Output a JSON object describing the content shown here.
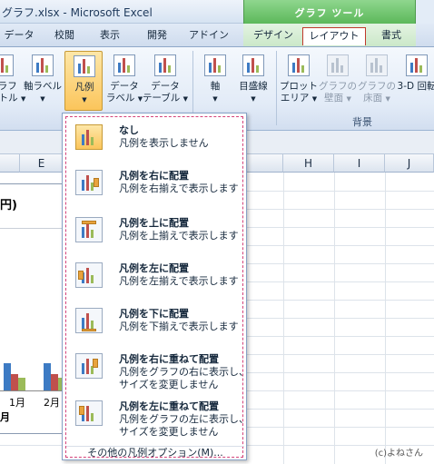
{
  "window": {
    "title": "グラフ.xlsx - Microsoft Excel",
    "context_tab_group": "グラフ ツール"
  },
  "tabs": [
    {
      "label": "データ"
    },
    {
      "label": "校閲"
    },
    {
      "label": "表示"
    },
    {
      "label": "開発"
    },
    {
      "label": "アドイン"
    },
    {
      "label": "デザイン"
    },
    {
      "label": "レイアウト",
      "active": true
    },
    {
      "label": "書式"
    }
  ],
  "ribbon": {
    "buttons": [
      {
        "line1": "グラフ",
        "line2": "タイトル",
        "icon": "chart-title-icon"
      },
      {
        "line1": "軸ラベル",
        "line2": "",
        "icon": "axis-label-icon"
      },
      {
        "line1": "凡例",
        "line2": "",
        "icon": "legend-icon",
        "pressed": true
      },
      {
        "line1": "データ",
        "line2": "ラベル",
        "icon": "data-label-icon"
      },
      {
        "line1": "データ",
        "line2": "テーブル",
        "icon": "data-table-icon"
      },
      {
        "line1": "軸",
        "line2": "",
        "icon": "axis-icon"
      },
      {
        "line1": "目盛線",
        "line2": "",
        "icon": "gridlines-icon"
      },
      {
        "line1": "プロット",
        "line2": "エリア",
        "icon": "plot-area-icon"
      },
      {
        "line1": "グラフの",
        "line2": "壁面",
        "icon": "chart-wall-icon",
        "disabled": true
      },
      {
        "line1": "グラフの",
        "line2": "床面",
        "icon": "chart-floor-icon",
        "disabled": true
      },
      {
        "line1": "3-D 回転",
        "line2": "",
        "icon": "3d-rotation-icon"
      }
    ],
    "group_label_background": "背景"
  },
  "sheet": {
    "columns": [
      "E",
      "H",
      "I",
      "J"
    ],
    "chart_title_partial": "円)",
    "month_labels": [
      "1月",
      "2月"
    ],
    "month_suffix": "月",
    "credit": "(c)よねさん"
  },
  "legend_menu": {
    "items": [
      {
        "title": "なし",
        "desc": "凡例を表示しません",
        "icon": "legend-none-icon",
        "selected": true
      },
      {
        "title": "凡例を右に配置",
        "desc": "凡例を右揃えで表示します",
        "icon": "legend-right-icon"
      },
      {
        "title": "凡例を上に配置",
        "desc": "凡例を上揃えで表示します",
        "icon": "legend-top-icon"
      },
      {
        "title": "凡例を左に配置",
        "desc": "凡例を左揃えで表示します",
        "icon": "legend-left-icon"
      },
      {
        "title": "凡例を下に配置",
        "desc": "凡例を下揃えで表示します",
        "icon": "legend-bottom-icon"
      },
      {
        "title": "凡例を右に重ねて配置",
        "desc": "凡例をグラフの右に表示し、",
        "desc2": "サイズを変更しません",
        "icon": "legend-overlay-right-icon"
      },
      {
        "title": "凡例を左に重ねて配置",
        "desc": "凡例をグラフの左に表示し、",
        "desc2": "サイズを変更しません",
        "icon": "legend-overlay-left-icon"
      }
    ],
    "more_options": "その他の凡例オプション(M)..."
  },
  "colors": {
    "context_green": "#5cb85a",
    "active_tab_border": "#c0392b",
    "pressed_button": "#fbc55b",
    "series_blue": "#3d7bc4",
    "series_red": "#c0504d",
    "series_green": "#9bbb59"
  }
}
